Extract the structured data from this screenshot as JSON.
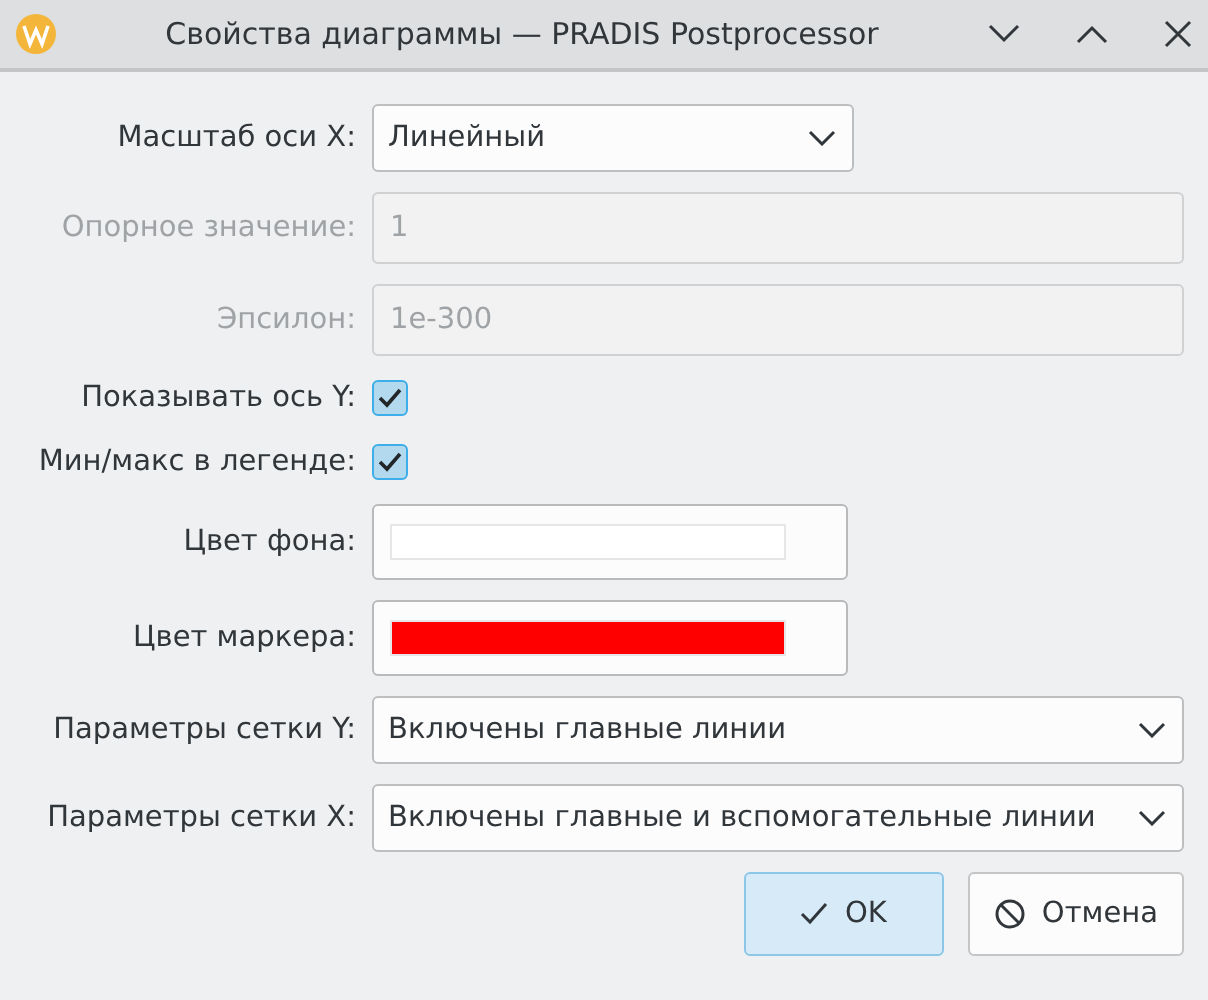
{
  "window": {
    "title": "Свойства диаграммы — PRADIS Postprocessor"
  },
  "fields": [
    {
      "kind": "select",
      "label": "Масштаб оси X:",
      "value": "Линейный",
      "disabled": false,
      "wide": false
    },
    {
      "kind": "input",
      "label": "Опорное значение:",
      "value": "1",
      "disabled": true,
      "wide": true
    },
    {
      "kind": "input",
      "label": "Эпсилон:",
      "value": "1e-300",
      "disabled": true,
      "wide": true
    },
    {
      "kind": "checkbox",
      "label": "Показывать ось Y:",
      "checked": true
    },
    {
      "kind": "checkbox",
      "label": "Мин/макс в легенде:",
      "checked": true
    },
    {
      "kind": "color",
      "label": "Цвет фона:",
      "color": "#ffffff"
    },
    {
      "kind": "color",
      "label": "Цвет маркера:",
      "color": "#ff0000"
    },
    {
      "kind": "select",
      "label": "Параметры сетки Y:",
      "value": "Включены главные линии",
      "disabled": false,
      "wide": true
    },
    {
      "kind": "select",
      "label": "Параметры сетки X:",
      "value": "Включены главные и вспомогательные линии",
      "disabled": false,
      "wide": true
    }
  ],
  "buttons": [
    {
      "label": "OK",
      "kind": "ok",
      "default": true
    },
    {
      "label": "Отмена",
      "kind": "cancel",
      "default": false
    }
  ]
}
